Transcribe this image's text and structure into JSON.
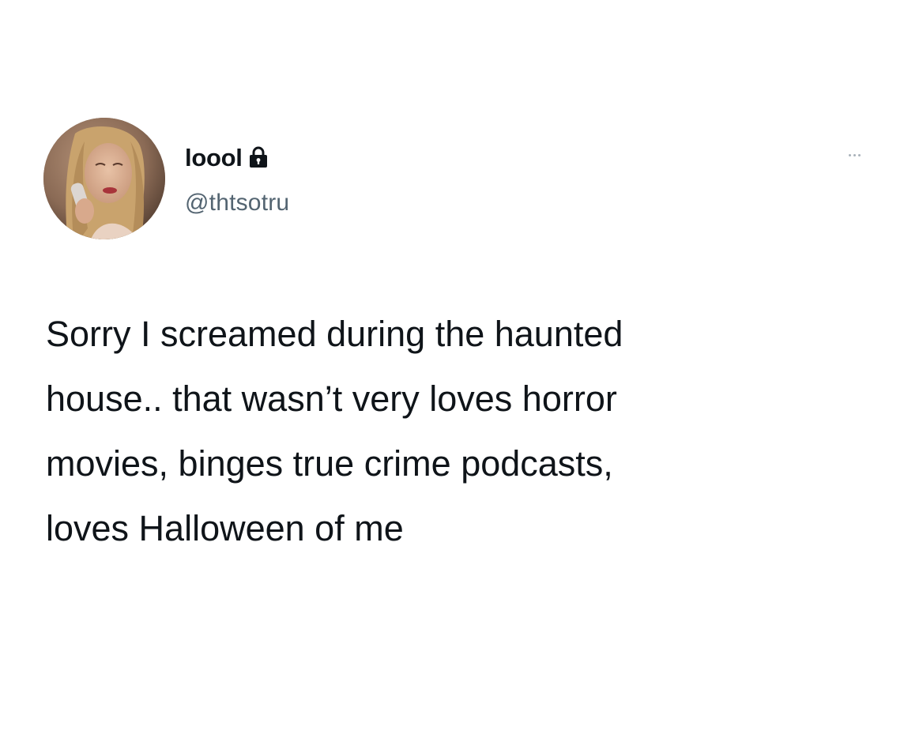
{
  "tweet": {
    "author": {
      "display_name": "loool",
      "handle": "@thtsotru",
      "protected_icon": "lock-icon",
      "avatar_icon": "avatar-photo"
    },
    "more_icon": "more-options-icon",
    "text_lines": [
      "Sorry I screamed during the haunted",
      "house.. that wasn’t very loves horror",
      "movies, binges true crime podcasts,",
      "loves Halloween of me"
    ]
  },
  "colors": {
    "background": "#ffffff",
    "primary_text": "#0f1419",
    "secondary_text": "#536471",
    "more_dots": "#a9b2ba"
  }
}
